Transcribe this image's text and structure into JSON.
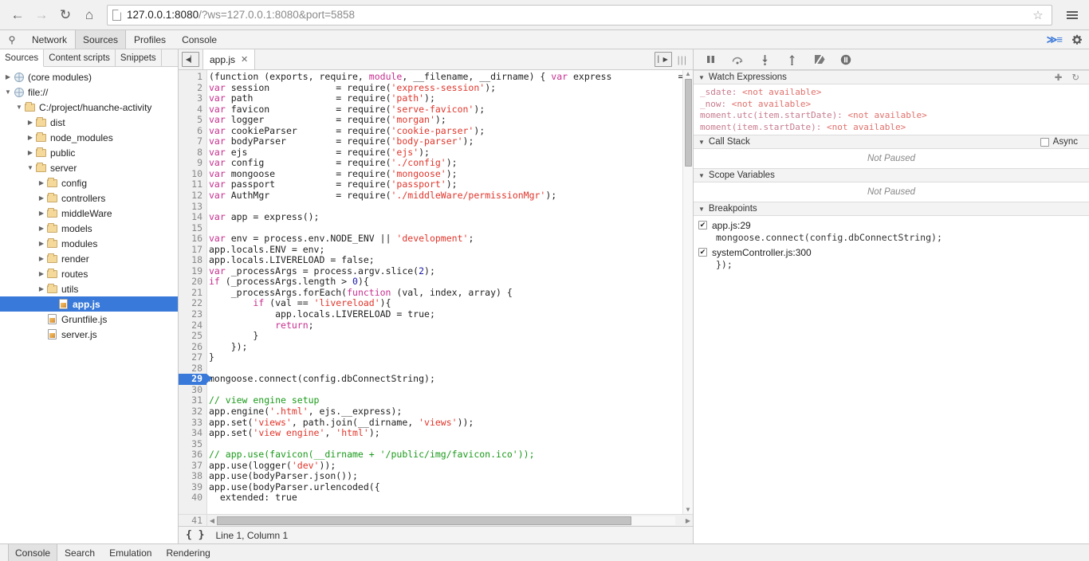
{
  "browser": {
    "back_icon": "arrow-left-icon",
    "forward_icon": "arrow-right-icon",
    "reload_icon": "reload-icon",
    "home_icon": "home-icon",
    "url_host": "127.0.0.1:8080",
    "url_query": "/?ws=127.0.0.1:8080&port=5858",
    "star_icon": "star-icon",
    "menu_icon": "hamburger-menu-icon"
  },
  "devtools": {
    "search_icon": "search-icon",
    "tabs": [
      {
        "label": "Network",
        "active": false
      },
      {
        "label": "Sources",
        "active": true
      },
      {
        "label": "Profiles",
        "active": false
      },
      {
        "label": "Console",
        "active": false
      }
    ],
    "drawer_toggle_icon": "show-drawer-icon",
    "settings_icon": "gear-icon"
  },
  "navigator": {
    "tabs": [
      {
        "label": "Sources",
        "active": true
      },
      {
        "label": "Content scripts",
        "active": false
      },
      {
        "label": "Snippets",
        "active": false
      }
    ],
    "tree": [
      {
        "label": "(core modules)",
        "indent": 0,
        "twisty": "right",
        "icon": "globe-icon",
        "selected": false
      },
      {
        "label": "file://",
        "indent": 0,
        "twisty": "down",
        "icon": "globe-icon",
        "selected": false
      },
      {
        "label": "C:/project/huanche-activity",
        "indent": 1,
        "twisty": "down",
        "icon": "folder-icon",
        "selected": false
      },
      {
        "label": "dist",
        "indent": 2,
        "twisty": "right",
        "icon": "folder-icon",
        "selected": false
      },
      {
        "label": "node_modules",
        "indent": 2,
        "twisty": "right",
        "icon": "folder-icon",
        "selected": false
      },
      {
        "label": "public",
        "indent": 2,
        "twisty": "right",
        "icon": "folder-icon",
        "selected": false
      },
      {
        "label": "server",
        "indent": 2,
        "twisty": "down",
        "icon": "folder-icon",
        "selected": false
      },
      {
        "label": "config",
        "indent": 3,
        "twisty": "right",
        "icon": "folder-icon",
        "selected": false
      },
      {
        "label": "controllers",
        "indent": 3,
        "twisty": "right",
        "icon": "folder-icon",
        "selected": false
      },
      {
        "label": "middleWare",
        "indent": 3,
        "twisty": "right",
        "icon": "folder-icon",
        "selected": false
      },
      {
        "label": "models",
        "indent": 3,
        "twisty": "right",
        "icon": "folder-icon",
        "selected": false
      },
      {
        "label": "modules",
        "indent": 3,
        "twisty": "right",
        "icon": "folder-icon",
        "selected": false
      },
      {
        "label": "render",
        "indent": 3,
        "twisty": "right",
        "icon": "folder-icon",
        "selected": false
      },
      {
        "label": "routes",
        "indent": 3,
        "twisty": "right",
        "icon": "folder-icon",
        "selected": false
      },
      {
        "label": "utils",
        "indent": 3,
        "twisty": "right",
        "icon": "folder-icon",
        "selected": false
      },
      {
        "label": "app.js",
        "indent": 4,
        "twisty": "none",
        "icon": "js-file-icon",
        "selected": true
      },
      {
        "label": "Gruntfile.js",
        "indent": 3,
        "twisty": "none",
        "icon": "js-file-icon",
        "selected": false
      },
      {
        "label": "server.js",
        "indent": 3,
        "twisty": "none",
        "icon": "js-file-icon",
        "selected": false
      }
    ]
  },
  "editor": {
    "nav_toggle_icon": "collapse-navigator-icon",
    "tab_label": "app.js",
    "tab_close_icon": "close-icon",
    "sidebar_toggle_icon": "expand-sidebar-icon",
    "grip_icon": "drag-handle-icon",
    "pretty_print_icon": "pretty-print-icon",
    "cursor_position": "Line 1, Column 1",
    "first_line_number": 1,
    "last_line_number": 41,
    "breakpoint_line": 29,
    "lines": [
      {
        "n": 1,
        "tokens": [
          {
            "t": "(function (exports, require, ",
            "c": ""
          },
          {
            "t": "module",
            "c": "kw"
          },
          {
            "t": ", __filename, __dirname) { ",
            "c": ""
          },
          {
            "t": "var",
            "c": "kw"
          },
          {
            "t": " express            = requir",
            "c": ""
          }
        ]
      },
      {
        "n": 2,
        "tokens": [
          {
            "t": "var",
            "c": "kw"
          },
          {
            "t": " session            = require(",
            "c": ""
          },
          {
            "t": "'express-session'",
            "c": "str"
          },
          {
            "t": ");",
            "c": ""
          }
        ]
      },
      {
        "n": 3,
        "tokens": [
          {
            "t": "var",
            "c": "kw"
          },
          {
            "t": " path               = require(",
            "c": ""
          },
          {
            "t": "'path'",
            "c": "str"
          },
          {
            "t": ");",
            "c": ""
          }
        ]
      },
      {
        "n": 4,
        "tokens": [
          {
            "t": "var",
            "c": "kw"
          },
          {
            "t": " favicon            = require(",
            "c": ""
          },
          {
            "t": "'serve-favicon'",
            "c": "str"
          },
          {
            "t": ");",
            "c": ""
          }
        ]
      },
      {
        "n": 5,
        "tokens": [
          {
            "t": "var",
            "c": "kw"
          },
          {
            "t": " logger             = require(",
            "c": ""
          },
          {
            "t": "'morgan'",
            "c": "str"
          },
          {
            "t": ");",
            "c": ""
          }
        ]
      },
      {
        "n": 6,
        "tokens": [
          {
            "t": "var",
            "c": "kw"
          },
          {
            "t": " cookieParser       = require(",
            "c": ""
          },
          {
            "t": "'cookie-parser'",
            "c": "str"
          },
          {
            "t": ");",
            "c": ""
          }
        ]
      },
      {
        "n": 7,
        "tokens": [
          {
            "t": "var",
            "c": "kw"
          },
          {
            "t": " bodyParser         = require(",
            "c": ""
          },
          {
            "t": "'body-parser'",
            "c": "str"
          },
          {
            "t": ");",
            "c": ""
          }
        ]
      },
      {
        "n": 8,
        "tokens": [
          {
            "t": "var",
            "c": "kw"
          },
          {
            "t": " ejs                = require(",
            "c": ""
          },
          {
            "t": "'ejs'",
            "c": "str"
          },
          {
            "t": ");",
            "c": ""
          }
        ]
      },
      {
        "n": 9,
        "tokens": [
          {
            "t": "var",
            "c": "kw"
          },
          {
            "t": " config             = require(",
            "c": ""
          },
          {
            "t": "'./config'",
            "c": "str"
          },
          {
            "t": ");",
            "c": ""
          }
        ]
      },
      {
        "n": 10,
        "tokens": [
          {
            "t": "var",
            "c": "kw"
          },
          {
            "t": " mongoose           = require(",
            "c": ""
          },
          {
            "t": "'mongoose'",
            "c": "str"
          },
          {
            "t": ");",
            "c": ""
          }
        ]
      },
      {
        "n": 11,
        "tokens": [
          {
            "t": "var",
            "c": "kw"
          },
          {
            "t": " passport           = require(",
            "c": ""
          },
          {
            "t": "'passport'",
            "c": "str"
          },
          {
            "t": ");",
            "c": ""
          }
        ]
      },
      {
        "n": 12,
        "tokens": [
          {
            "t": "var",
            "c": "kw"
          },
          {
            "t": " AuthMgr            = require(",
            "c": ""
          },
          {
            "t": "'./middleWare/permissionMgr'",
            "c": "str"
          },
          {
            "t": ");",
            "c": ""
          }
        ]
      },
      {
        "n": 13,
        "tokens": []
      },
      {
        "n": 14,
        "tokens": [
          {
            "t": "var",
            "c": "kw"
          },
          {
            "t": " app = express();",
            "c": ""
          }
        ]
      },
      {
        "n": 15,
        "tokens": []
      },
      {
        "n": 16,
        "tokens": [
          {
            "t": "var",
            "c": "kw"
          },
          {
            "t": " env = process.env.NODE_ENV || ",
            "c": ""
          },
          {
            "t": "'development'",
            "c": "str"
          },
          {
            "t": ";",
            "c": ""
          }
        ]
      },
      {
        "n": 17,
        "tokens": [
          {
            "t": "app.locals.ENV = env;",
            "c": ""
          }
        ]
      },
      {
        "n": 18,
        "tokens": [
          {
            "t": "app.locals.LIVERELOAD = false;",
            "c": ""
          }
        ]
      },
      {
        "n": 19,
        "tokens": [
          {
            "t": "var",
            "c": "kw"
          },
          {
            "t": " _processArgs = process.argv.slice(",
            "c": ""
          },
          {
            "t": "2",
            "c": "num"
          },
          {
            "t": ");",
            "c": ""
          }
        ]
      },
      {
        "n": 20,
        "tokens": [
          {
            "t": "if",
            "c": "kw"
          },
          {
            "t": " (_processArgs.length > ",
            "c": ""
          },
          {
            "t": "0",
            "c": "num"
          },
          {
            "t": "){",
            "c": ""
          }
        ]
      },
      {
        "n": 21,
        "tokens": [
          {
            "t": "    _processArgs.forEach(",
            "c": ""
          },
          {
            "t": "function",
            "c": "kw"
          },
          {
            "t": " (val, index, array) {",
            "c": ""
          }
        ]
      },
      {
        "n": 22,
        "tokens": [
          {
            "t": "        ",
            "c": ""
          },
          {
            "t": "if",
            "c": "kw"
          },
          {
            "t": " (val == ",
            "c": ""
          },
          {
            "t": "'livereload'",
            "c": "str"
          },
          {
            "t": "){",
            "c": ""
          }
        ]
      },
      {
        "n": 23,
        "tokens": [
          {
            "t": "            app.locals.LIVERELOAD = true;",
            "c": ""
          }
        ]
      },
      {
        "n": 24,
        "tokens": [
          {
            "t": "            ",
            "c": ""
          },
          {
            "t": "return",
            "c": "kw"
          },
          {
            "t": ";",
            "c": ""
          }
        ]
      },
      {
        "n": 25,
        "tokens": [
          {
            "t": "        }",
            "c": ""
          }
        ]
      },
      {
        "n": 26,
        "tokens": [
          {
            "t": "    });",
            "c": ""
          }
        ]
      },
      {
        "n": 27,
        "tokens": [
          {
            "t": "}",
            "c": ""
          }
        ]
      },
      {
        "n": 28,
        "tokens": []
      },
      {
        "n": 29,
        "tokens": [
          {
            "t": "mongoose.connect(config.dbConnectString);",
            "c": ""
          }
        ]
      },
      {
        "n": 30,
        "tokens": []
      },
      {
        "n": 31,
        "tokens": [
          {
            "t": "// view engine setup",
            "c": "cmt"
          }
        ]
      },
      {
        "n": 32,
        "tokens": [
          {
            "t": "app.engine(",
            "c": ""
          },
          {
            "t": "'.html'",
            "c": "str"
          },
          {
            "t": ", ejs.__express);",
            "c": ""
          }
        ]
      },
      {
        "n": 33,
        "tokens": [
          {
            "t": "app.set(",
            "c": ""
          },
          {
            "t": "'views'",
            "c": "str"
          },
          {
            "t": ", path.join(__dirname, ",
            "c": ""
          },
          {
            "t": "'views'",
            "c": "str"
          },
          {
            "t": "));",
            "c": ""
          }
        ]
      },
      {
        "n": 34,
        "tokens": [
          {
            "t": "app.set(",
            "c": ""
          },
          {
            "t": "'view engine'",
            "c": "str"
          },
          {
            "t": ", ",
            "c": ""
          },
          {
            "t": "'html'",
            "c": "str"
          },
          {
            "t": ");",
            "c": ""
          }
        ]
      },
      {
        "n": 35,
        "tokens": []
      },
      {
        "n": 36,
        "tokens": [
          {
            "t": "// app.use(favicon(__dirname + '/public/img/favicon.ico'));",
            "c": "cmt"
          }
        ]
      },
      {
        "n": 37,
        "tokens": [
          {
            "t": "app.use(logger(",
            "c": ""
          },
          {
            "t": "'dev'",
            "c": "str"
          },
          {
            "t": "));",
            "c": ""
          }
        ]
      },
      {
        "n": 38,
        "tokens": [
          {
            "t": "app.use(bodyParser.json());",
            "c": ""
          }
        ]
      },
      {
        "n": 39,
        "tokens": [
          {
            "t": "app.use(bodyParser.urlencoded({",
            "c": ""
          }
        ]
      },
      {
        "n": 40,
        "tokens": [
          {
            "t": "  extended: true",
            "c": ""
          }
        ]
      }
    ]
  },
  "debugger": {
    "controls": [
      {
        "name": "pause-resume-button",
        "glyph": "pause"
      },
      {
        "name": "step-over-button",
        "glyph": "step-over"
      },
      {
        "name": "step-into-button",
        "glyph": "step-into"
      },
      {
        "name": "step-out-button",
        "glyph": "step-out"
      },
      {
        "name": "deactivate-breakpoints-button",
        "glyph": "deactivate"
      },
      {
        "name": "pause-on-exceptions-button",
        "glyph": "exceptions"
      }
    ],
    "watch": {
      "title": "Watch Expressions",
      "add_icon": "plus-icon",
      "refresh_icon": "refresh-icon",
      "rows": [
        {
          "expr": "_sdate: ",
          "value": "<not available>"
        },
        {
          "expr": "_now: ",
          "value": "<not available>"
        },
        {
          "expr": "moment.utc(item.startDate): ",
          "value": "<not available>"
        },
        {
          "expr": "moment(item.startDate): ",
          "value": "<not available>"
        }
      ]
    },
    "call_stack": {
      "title": "Call Stack",
      "async_label": "Async",
      "async_checked": false,
      "empty_text": "Not Paused"
    },
    "scope": {
      "title": "Scope Variables",
      "empty_text": "Not Paused"
    },
    "breakpoints": {
      "title": "Breakpoints",
      "items": [
        {
          "location": "app.js:29",
          "snippet": "mongoose.connect(config.dbConnectString);",
          "checked": true
        },
        {
          "location": "systemController.js:300",
          "snippet": "});",
          "checked": true
        }
      ]
    }
  },
  "drawer": {
    "tabs": [
      {
        "label": "Console",
        "active": true
      },
      {
        "label": "Search",
        "active": false
      },
      {
        "label": "Emulation",
        "active": false
      },
      {
        "label": "Rendering",
        "active": false
      }
    ]
  }
}
